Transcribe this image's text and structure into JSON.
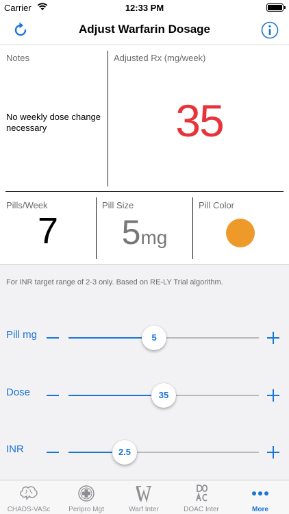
{
  "status": {
    "carrier": "Carrier",
    "time": "12:33 PM"
  },
  "nav": {
    "title": "Adjust Warfarin Dosage",
    "left_icon": "refresh-icon",
    "right_icon": "info-icon"
  },
  "panel": {
    "notes_label": "Notes",
    "notes_text": "No weekly dose change necessary",
    "rx_label": "Adjusted Rx (mg/week)",
    "rx_value": "35",
    "pills_label": "Pills/Week",
    "pills_value": "7",
    "size_label": "Pill Size",
    "size_value": "5",
    "size_unit": "mg",
    "color_label": "Pill Color",
    "pill_color": "#ee9a2b",
    "rx_color": "#e8333a"
  },
  "note": "For INR target range of 2-3 only. Based on RE-LY Trial algorithm.",
  "sliders": [
    {
      "name": "Pill mg",
      "value": "5",
      "fraction": 0.45
    },
    {
      "name": "Dose",
      "value": "35",
      "fraction": 0.5
    },
    {
      "name": "INR",
      "value": "2.5",
      "fraction": 0.295
    }
  ],
  "tabs": [
    {
      "label": "CHADS-VASc",
      "icon": "brain-icon",
      "active": false
    },
    {
      "label": "Peripro Mgt",
      "icon": "medical-cross-icon",
      "active": false
    },
    {
      "label": "Warf Inter",
      "icon": "w-letter-icon",
      "active": false
    },
    {
      "label": "DOAC Inter",
      "icon": "doac-icon",
      "active": false
    },
    {
      "label": "More",
      "icon": "more-dots-icon",
      "active": true
    }
  ],
  "accent": "#1a74d8"
}
